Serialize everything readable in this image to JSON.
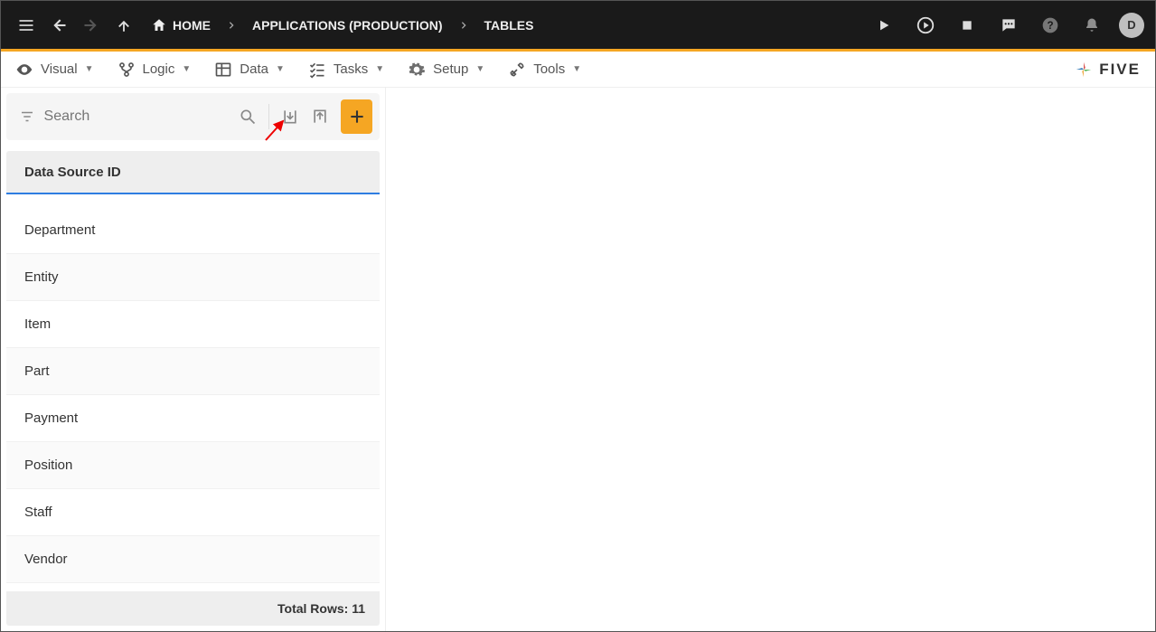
{
  "topbar": {
    "breadcrumbs": [
      {
        "label": "HOME",
        "has_home_icon": true
      },
      {
        "label": "APPLICATIONS (PRODUCTION)"
      },
      {
        "label": "TABLES"
      }
    ],
    "avatar_initial": "D"
  },
  "menu": {
    "items": [
      {
        "label": "Visual",
        "icon": "eye"
      },
      {
        "label": "Logic",
        "icon": "branch"
      },
      {
        "label": "Data",
        "icon": "table"
      },
      {
        "label": "Tasks",
        "icon": "checklist"
      },
      {
        "label": "Setup",
        "icon": "gear"
      },
      {
        "label": "Tools",
        "icon": "wrench"
      }
    ],
    "brand": "FIVE"
  },
  "panel": {
    "search_placeholder": "Search",
    "column_header": "Data Source ID",
    "rows": [
      "Department",
      "Entity",
      "Item",
      "Part",
      "Payment",
      "Position",
      "Staff",
      "Vendor"
    ],
    "footer_label": "Total Rows:",
    "footer_count": "11"
  }
}
